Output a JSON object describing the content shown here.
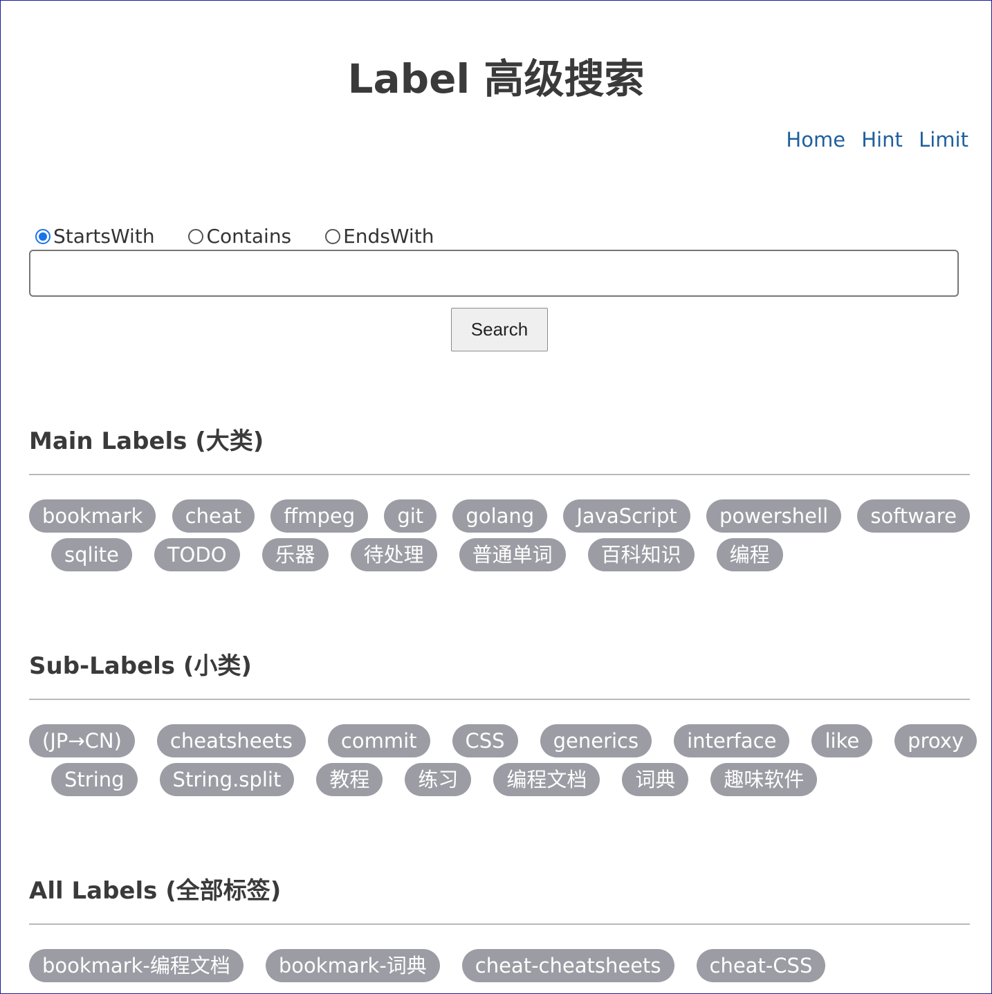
{
  "title": "Label 高级搜索",
  "nav": [
    "Home",
    "Hint",
    "Limit"
  ],
  "search": {
    "modes": [
      {
        "label": "StartsWith",
        "checked": true
      },
      {
        "label": "Contains",
        "checked": false
      },
      {
        "label": "EndsWith",
        "checked": false
      }
    ],
    "value": "",
    "button_label": "Search"
  },
  "sections": {
    "main": {
      "title": "Main Labels (大类)",
      "rows": [
        [
          "bookmark",
          "cheat",
          "ffmpeg",
          "git",
          "golang",
          "JavaScript",
          "powershell",
          "software"
        ],
        [
          "sqlite",
          "TODO",
          "乐器",
          "待处理",
          "普通单词",
          "百科知识",
          "编程"
        ]
      ]
    },
    "sub": {
      "title": "Sub-Labels (小类)",
      "rows": [
        [
          "(JP→CN)",
          "cheatsheets",
          "commit",
          "CSS",
          "generics",
          "interface",
          "like",
          "proxy"
        ],
        [
          "String",
          "String.split",
          "教程",
          "练习",
          "编程文档",
          "词典",
          "趣味软件"
        ]
      ]
    },
    "all": {
      "title": "All Labels (全部标签)",
      "rows": [
        [
          "bookmark-编程文档",
          "bookmark-词典",
          "cheat-cheatsheets",
          "cheat-CSS"
        ]
      ]
    }
  }
}
